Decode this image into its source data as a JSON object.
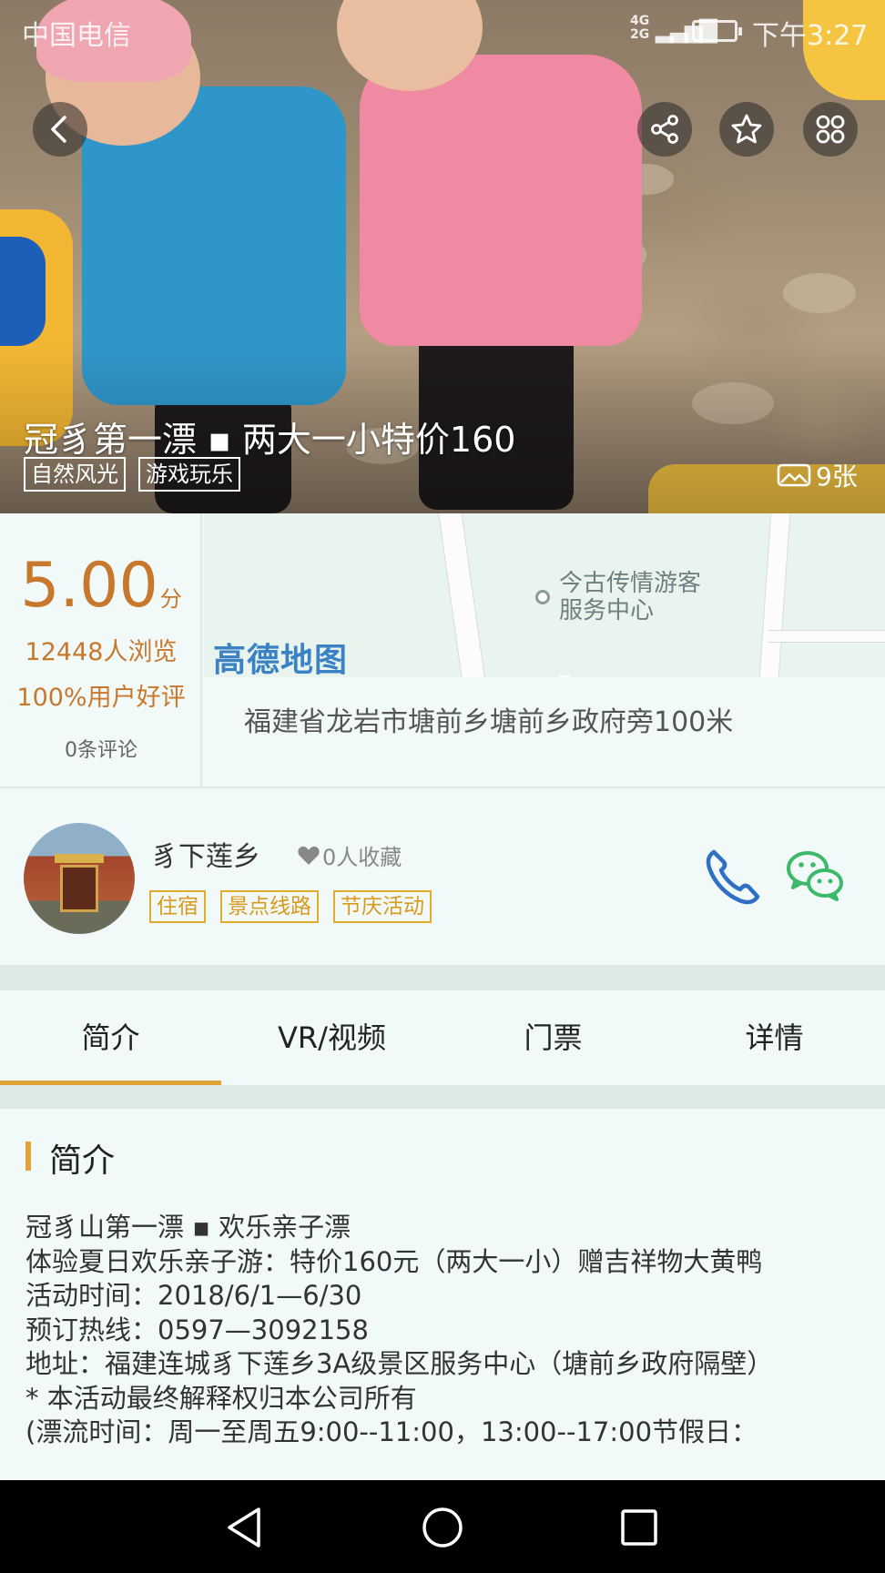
{
  "status_bar": {
    "carrier": "中国电信",
    "network_top": "4G",
    "network_bottom": "2G",
    "time": "下午3:27"
  },
  "hero": {
    "title": "冠豸第一漂 ▪ 两大一小特价160",
    "tags": [
      "自然风光",
      "游戏玩乐"
    ],
    "photo_count": "9张"
  },
  "rating": {
    "score": "5.00",
    "score_unit": "分",
    "views": "12448人浏览",
    "good_rate": "100%用户好评",
    "comments": "0条评论"
  },
  "map": {
    "poi_label": "今古传情游客服务中心",
    "brand": "高德地图",
    "address": "福建省龙岩市塘前乡塘前乡政府旁100米"
  },
  "merchant": {
    "name": "豸下莲乡",
    "favorites": "0人收藏",
    "tags": [
      "住宿",
      "景点线路",
      "节庆活动"
    ]
  },
  "tabs": [
    {
      "label": "简介",
      "active": true
    },
    {
      "label": "VR/视频",
      "active": false
    },
    {
      "label": "门票",
      "active": false
    },
    {
      "label": "详情",
      "active": false
    }
  ],
  "intro": {
    "title": "简介",
    "lines": [
      "冠豸山第一漂 ▪ 欢乐亲子漂",
      "体验夏日欢乐亲子游：特价160元（两大一小）赠吉祥物大黄鸭",
      "活动时间：2018/6/1—6/30",
      "预订热线：0597—3092158",
      "地址：福建连城豸下莲乡3A级景区服务中心（塘前乡政府隔壁）",
      "* 本活动最终解释权归本公司所有",
      "(漂流时间：周一至周五9:00--11:00，13:00--17:00节假日："
    ]
  },
  "colors": {
    "accent": "#e2a43a",
    "score": "#c8782c",
    "tag_border": "#e0ac2a",
    "phone": "#2f6fc4",
    "wechat": "#3eb86a"
  },
  "icons": {
    "back": "back-arrow-icon",
    "share": "share-icon",
    "favorite": "star-icon",
    "menu": "grid-menu-icon",
    "photo": "photo-gallery-icon",
    "heart": "heart-icon",
    "phone": "phone-icon",
    "wechat": "wechat-icon"
  }
}
